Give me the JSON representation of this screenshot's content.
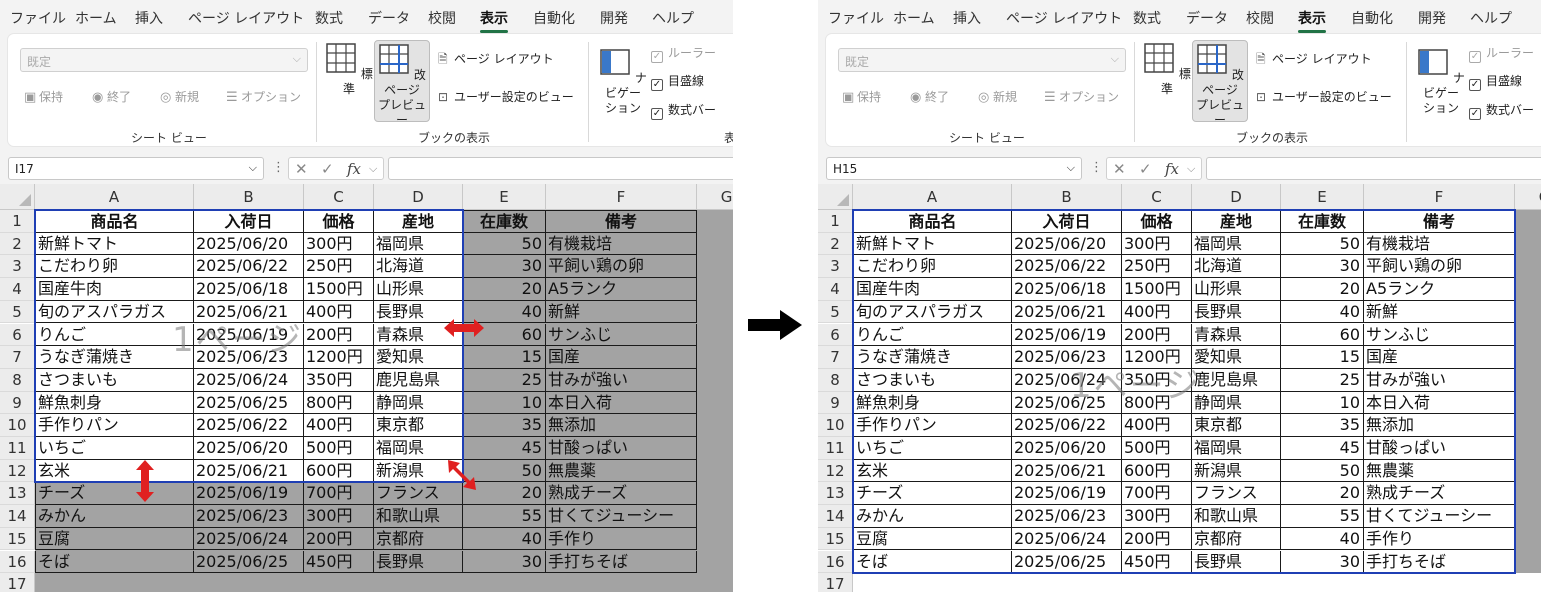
{
  "menu": [
    "ファイル",
    "ホーム",
    "挿入",
    "ページ レイアウト",
    "数式",
    "データ",
    "校閲",
    "表示",
    "自動化",
    "開発",
    "ヘルプ"
  ],
  "active_menu": "表示",
  "ribbon": {
    "sheet_view": {
      "select_value": "既定",
      "buttons": [
        "保持",
        "終了",
        "新規",
        "オプション"
      ],
      "group_label": "シート ビュー"
    },
    "workbook_views": {
      "normal": "標準",
      "page_break_preview_line1": "改ページ",
      "page_break_preview_line2": "プレビュー",
      "page_layout": "ページ レイアウト",
      "custom_views": "ユーザー設定のビュー",
      "group_label": "ブックの表示"
    },
    "show": {
      "navigation_line1": "ナビゲー",
      "navigation_line2": "ション",
      "ruler": "ルーラー",
      "gridlines": "目盛線",
      "formula_bar": "数式バー",
      "group_label_partial": "表"
    }
  },
  "left": {
    "name_box": "I17",
    "watermark": "1ページ"
  },
  "right": {
    "name_box": "H15",
    "watermark": "1ページ"
  },
  "formula": {
    "fx": "fx"
  },
  "columns": [
    "A",
    "B",
    "C",
    "D",
    "E",
    "F",
    "G"
  ],
  "rows": [
    "1",
    "2",
    "3",
    "4",
    "5",
    "6",
    "7",
    "8",
    "9",
    "10",
    "11",
    "12",
    "13",
    "14",
    "15",
    "16",
    "17"
  ],
  "table": {
    "headers": [
      "商品名",
      "入荷日",
      "価格",
      "産地",
      "在庫数",
      "備考"
    ],
    "rows": [
      [
        "新鮮トマト",
        "2025/06/20",
        "300円",
        "福岡県",
        "50",
        "有機栽培"
      ],
      [
        "こだわり卵",
        "2025/06/22",
        "250円",
        "北海道",
        "30",
        "平飼い鶏の卵"
      ],
      [
        "国産牛肉",
        "2025/06/18",
        "1500円",
        "山形県",
        "20",
        "A5ランク"
      ],
      [
        "旬のアスパラガス",
        "2025/06/21",
        "400円",
        "長野県",
        "40",
        "新鮮"
      ],
      [
        "りんご",
        "2025/06/19",
        "200円",
        "青森県",
        "60",
        "サンふじ"
      ],
      [
        "うなぎ蒲焼き",
        "2025/06/23",
        "1200円",
        "愛知県",
        "15",
        "国産"
      ],
      [
        "さつまいも",
        "2025/06/24",
        "350円",
        "鹿児島県",
        "25",
        "甘みが強い"
      ],
      [
        "鮮魚刺身",
        "2025/06/25",
        "800円",
        "静岡県",
        "10",
        "本日入荷"
      ],
      [
        "手作りパン",
        "2025/06/22",
        "400円",
        "東京都",
        "35",
        "無添加"
      ],
      [
        "いちご",
        "2025/06/20",
        "500円",
        "福岡県",
        "45",
        "甘酸っぱい"
      ],
      [
        "玄米",
        "2025/06/21",
        "600円",
        "新潟県",
        "50",
        "無農薬"
      ],
      [
        "チーズ",
        "2025/06/19",
        "700円",
        "フランス",
        "20",
        "熟成チーズ"
      ],
      [
        "みかん",
        "2025/06/23",
        "300円",
        "和歌山県",
        "55",
        "甘くてジューシー"
      ],
      [
        "豆腐",
        "2025/06/24",
        "200円",
        "京都府",
        "40",
        "手作り"
      ],
      [
        "そば",
        "2025/06/25",
        "450円",
        "長野県",
        "30",
        "手打ちそば"
      ]
    ]
  },
  "colors": {
    "page_break_line": "#1f3fb4",
    "outside_print_area": "#a3a3a3",
    "arrow_red": "#e02020",
    "tab_underline": "#217346"
  },
  "icons": [
    "save-view-icon",
    "exit-view-icon",
    "new-view-icon",
    "options-icon",
    "normal-view-icon",
    "page-break-preview-icon",
    "page-layout-icon",
    "custom-views-icon",
    "navigation-pane-icon",
    "right-arrow-icon"
  ]
}
